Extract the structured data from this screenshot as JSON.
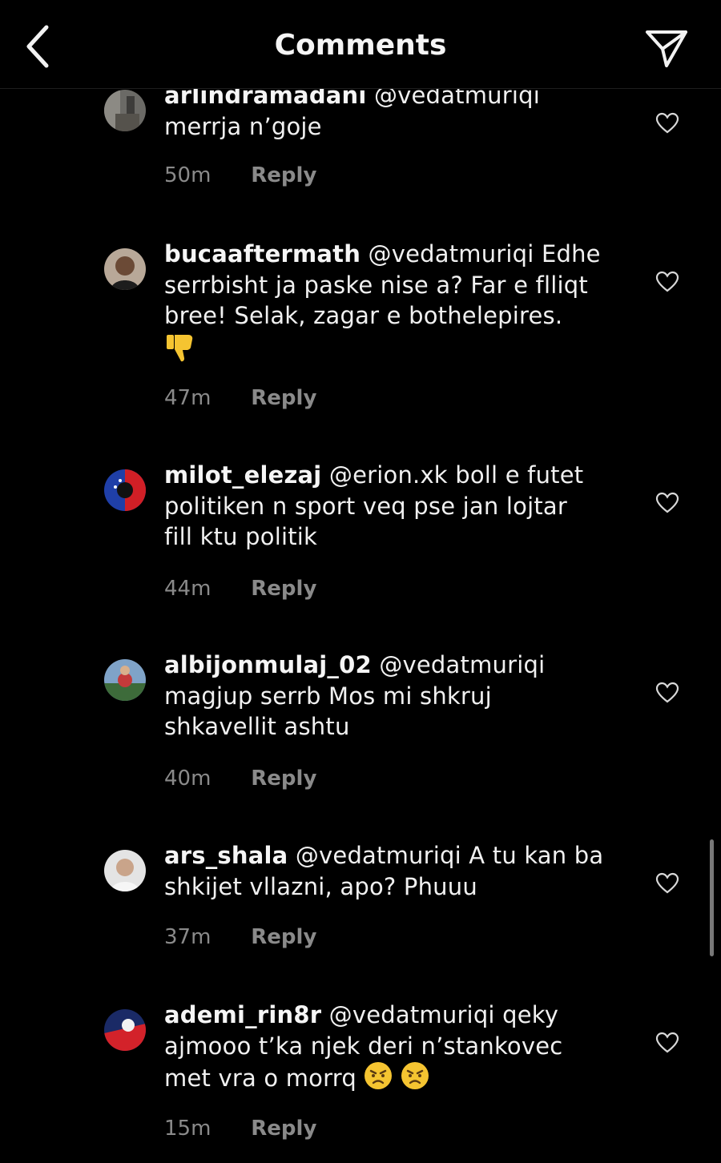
{
  "header": {
    "title": "Comments"
  },
  "comments": [
    {
      "username": "arlindramadani",
      "lines": [
        "@vedatmuriqi",
        "merrja n’goje"
      ],
      "time": "50m",
      "reply_label": "Reply"
    },
    {
      "username": "bucaaftermath",
      "lines": [
        "@vedatmuriqi Edhe",
        "serrbisht ja paske nise a? Far e flliqt",
        "bree! Selak, zagar e bothelepires."
      ],
      "emoji": "thumbs-down",
      "time": "47m",
      "reply_label": "Reply"
    },
    {
      "username": "milot_elezaj",
      "lines": [
        "@erion.xk boll e futet",
        "politiken n sport veq pse jan lojtar",
        "fill ktu politik"
      ],
      "time": "44m",
      "reply_label": "Reply"
    },
    {
      "username": "albijonmulaj_02",
      "lines": [
        "@vedatmuriqi",
        "magjup serrb Mos mi shkruj",
        "shkavellit ashtu"
      ],
      "time": "40m",
      "reply_label": "Reply"
    },
    {
      "username": "ars_shala",
      "lines": [
        "@vedatmuriqi A tu kan ba",
        "shkijet vllazni, apo? Phuuu"
      ],
      "time": "37m",
      "reply_label": "Reply"
    },
    {
      "username": "ademi_rin8r",
      "lines": [
        "@vedatmuriqi qeky",
        "ajmooo t’ka njek deri n’stankovec",
        "met vra o morrq"
      ],
      "emoji": "angry-face-x2",
      "time": "15m",
      "reply_label": "Reply"
    }
  ],
  "icons": {
    "back": "chevron-left-icon",
    "send": "paper-plane-icon",
    "like": "heart-outline-icon"
  },
  "colors": {
    "background": "#000000",
    "text": "#f0f0f0",
    "secondary": "#8a8a8a",
    "emoji_yellow": "#f5c431"
  }
}
